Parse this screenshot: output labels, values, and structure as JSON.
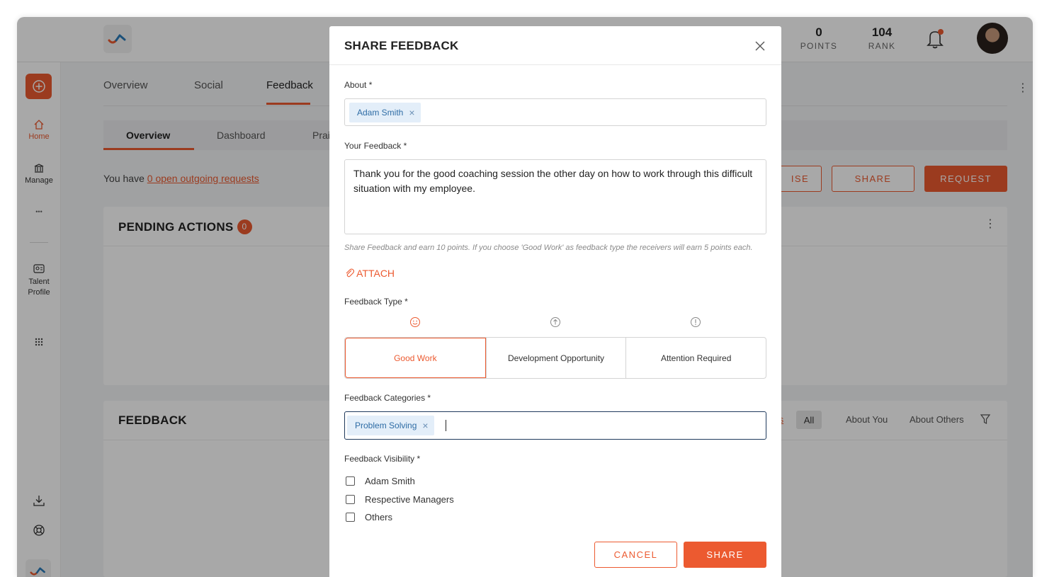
{
  "topbar": {
    "points_value": "0",
    "points_label": "POINTS",
    "rank_value": "104",
    "rank_label": "RANK"
  },
  "rail": {
    "home_label": "Home",
    "manage_label": "Manage",
    "more_label": "•••",
    "talent_label": "Talent Profile"
  },
  "main": {
    "tabs": [
      {
        "label": "Overview"
      },
      {
        "label": "Social"
      },
      {
        "label": "Feedback"
      }
    ],
    "subtabs": [
      {
        "label": "Overview"
      },
      {
        "label": "Dashboard"
      },
      {
        "label": "Prai"
      }
    ],
    "open_requests_prefix": "You have ",
    "open_requests_link": "0 open outgoing requests",
    "actions": {
      "praise_partial": "ISE",
      "share_label": "SHARE",
      "request_label": "REQUEST"
    },
    "pending_title": "PENDING ACTIONS",
    "pending_count": "0",
    "feedback_title": "FEEDBACK",
    "feedback_filters": {
      "partial": "ts",
      "all": "All",
      "about_you": "About You",
      "about_others": "About Others"
    }
  },
  "modal": {
    "title": "SHARE FEEDBACK",
    "about_label": "About *",
    "about_chip": "Adam Smith",
    "feedback_label": "Your Feedback *",
    "feedback_text": "Thank you for the good coaching session the other day on how to work through this difficult situation with my employee.",
    "hint": "Share Feedback and earn 10 points. If you choose 'Good Work' as feedback type the receivers will earn 5 points each.",
    "attach_label": "ATTACH",
    "type_label": "Feedback Type *",
    "types": [
      {
        "label": "Good Work",
        "selected": true
      },
      {
        "label": "Development Opportunity",
        "selected": false
      },
      {
        "label": "Attention Required",
        "selected": false
      }
    ],
    "categories_label": "Feedback Categories *",
    "category_chip": "Problem Solving",
    "visibility_label": "Feedback Visibility *",
    "visibility_options": [
      {
        "label": "Adam Smith",
        "checked": false
      },
      {
        "label": "Respective Managers",
        "checked": false
      },
      {
        "label": "Others",
        "checked": false
      }
    ],
    "cancel_label": "CANCEL",
    "share_label": "SHARE"
  },
  "colors": {
    "accent": "#ec5a30",
    "chip_bg": "#e3eef9",
    "chip_text": "#2e6ca5",
    "focus_border": "#1f3a5c"
  }
}
